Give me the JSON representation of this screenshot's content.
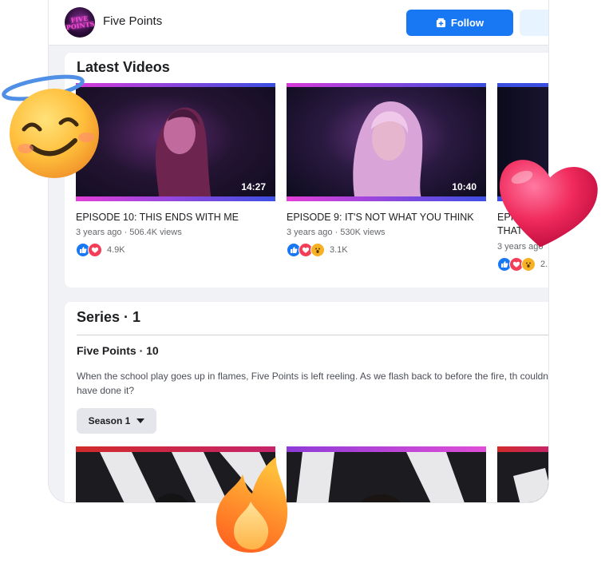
{
  "page": {
    "name": "Five Points",
    "avatar_text": "FIVE POINTS"
  },
  "actions": {
    "follow_label": "Follow"
  },
  "latest": {
    "title": "Latest Videos",
    "videos": [
      {
        "title": "EPISODE 10: THIS ENDS WITH ME",
        "age": "3 years ago",
        "views": "506.4K views",
        "duration": "14:27",
        "reactions": [
          "like",
          "love"
        ],
        "reaction_count": "4.9K"
      },
      {
        "title": "EPISODE 9: IT'S NOT WHAT YOU THINK",
        "age": "3 years ago",
        "views": "530K views",
        "duration": "10:40",
        "reactions": [
          "like",
          "love",
          "wow"
        ],
        "reaction_count": "3.1K"
      },
      {
        "title_line1": "EPI",
        "title_line2": "THAT",
        "age": "3 years ago",
        "views": "",
        "reactions": [
          "like",
          "love",
          "wow"
        ],
        "reaction_count": "2."
      }
    ]
  },
  "series": {
    "title": "Series · 1",
    "show_title": "Five Points · 10",
    "description": "When the school play goes up in flames, Five Points is left reeling. As we flash back to before the fire, th couldn't have done it?",
    "season_label": "Season 1"
  },
  "colors": {
    "accent": "#1877f2",
    "brand_pink": "#e83ee0",
    "background": "#f0f2f5"
  }
}
